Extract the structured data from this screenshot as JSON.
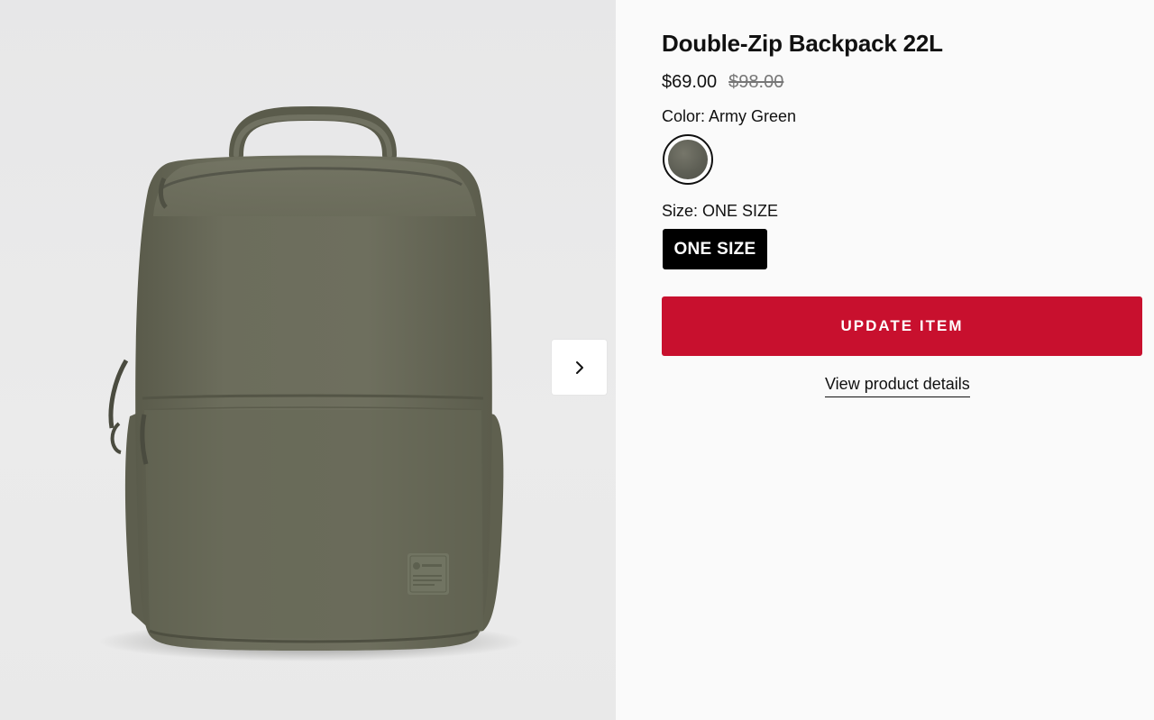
{
  "product": {
    "title": "Double-Zip Backpack 22L",
    "price_sale": "$69.00",
    "price_original": "$98.00"
  },
  "color": {
    "label": "Color: Army Green",
    "swatch_hex": "#5e5f55"
  },
  "size": {
    "label": "Size: ONE SIZE",
    "option": "ONE SIZE"
  },
  "actions": {
    "update_label": "UPDATE ITEM",
    "details_link": "View product details"
  },
  "gallery": {
    "next_icon": "chevron-right-icon"
  },
  "colors": {
    "accent": "#c8102e",
    "backpack": "#6a6b5a"
  }
}
